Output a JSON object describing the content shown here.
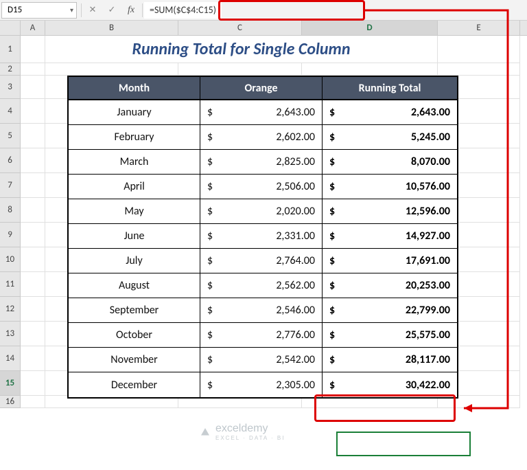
{
  "formula_bar": {
    "cell_ref": "D15",
    "formula": "=SUM($C$4:C15)"
  },
  "icons": {
    "dropdown": "▾",
    "cancel": "✕",
    "confirm": "✓",
    "fx": "fx"
  },
  "columns": [
    "A",
    "B",
    "C",
    "D",
    "E"
  ],
  "row_numbers": [
    1,
    2,
    3,
    4,
    5,
    6,
    7,
    8,
    9,
    10,
    11,
    12,
    13,
    14,
    15,
    16
  ],
  "selected_column": "D",
  "selected_row": 15,
  "title": "Running Total for Single Column",
  "headers": {
    "month": "Month",
    "orange": "Orange",
    "running": "Running Total"
  },
  "currency": "$",
  "chart_data": {
    "type": "table",
    "title": "Running Total for Single Column",
    "columns": [
      "Month",
      "Orange",
      "Running Total"
    ],
    "rows": [
      {
        "month": "January",
        "orange": 2643.0,
        "running_total": 2643.0
      },
      {
        "month": "February",
        "orange": 2602.0,
        "running_total": 5245.0
      },
      {
        "month": "March",
        "orange": 2825.0,
        "running_total": 8070.0
      },
      {
        "month": "April",
        "orange": 2506.0,
        "running_total": 10576.0
      },
      {
        "month": "May",
        "orange": 2020.0,
        "running_total": 12596.0
      },
      {
        "month": "June",
        "orange": 2331.0,
        "running_total": 14927.0
      },
      {
        "month": "July",
        "orange": 2764.0,
        "running_total": 17691.0
      },
      {
        "month": "August",
        "orange": 2562.0,
        "running_total": 20253.0
      },
      {
        "month": "September",
        "orange": 2546.0,
        "running_total": 22799.0
      },
      {
        "month": "October",
        "orange": 2776.0,
        "running_total": 25575.0
      },
      {
        "month": "November",
        "orange": 2542.0,
        "running_total": 28117.0
      },
      {
        "month": "December",
        "orange": 2305.0,
        "running_total": 30422.0
      }
    ],
    "orange_display": [
      "2,643.00",
      "2,602.00",
      "2,825.00",
      "2,506.00",
      "2,020.00",
      "2,331.00",
      "2,764.00",
      "2,562.00",
      "2,546.00",
      "2,776.00",
      "2,542.00",
      "2,305.00"
    ],
    "running_display": [
      "2,643.00",
      "5,245.00",
      "8,070.00",
      "10,576.00",
      "12,596.00",
      "14,927.00",
      "17,691.00",
      "20,253.00",
      "22,799.00",
      "25,575.00",
      "28,117.00",
      "30,422.00"
    ]
  },
  "watermark": {
    "brand": "exceldemy",
    "tagline": "EXCEL · DATA · BI"
  }
}
